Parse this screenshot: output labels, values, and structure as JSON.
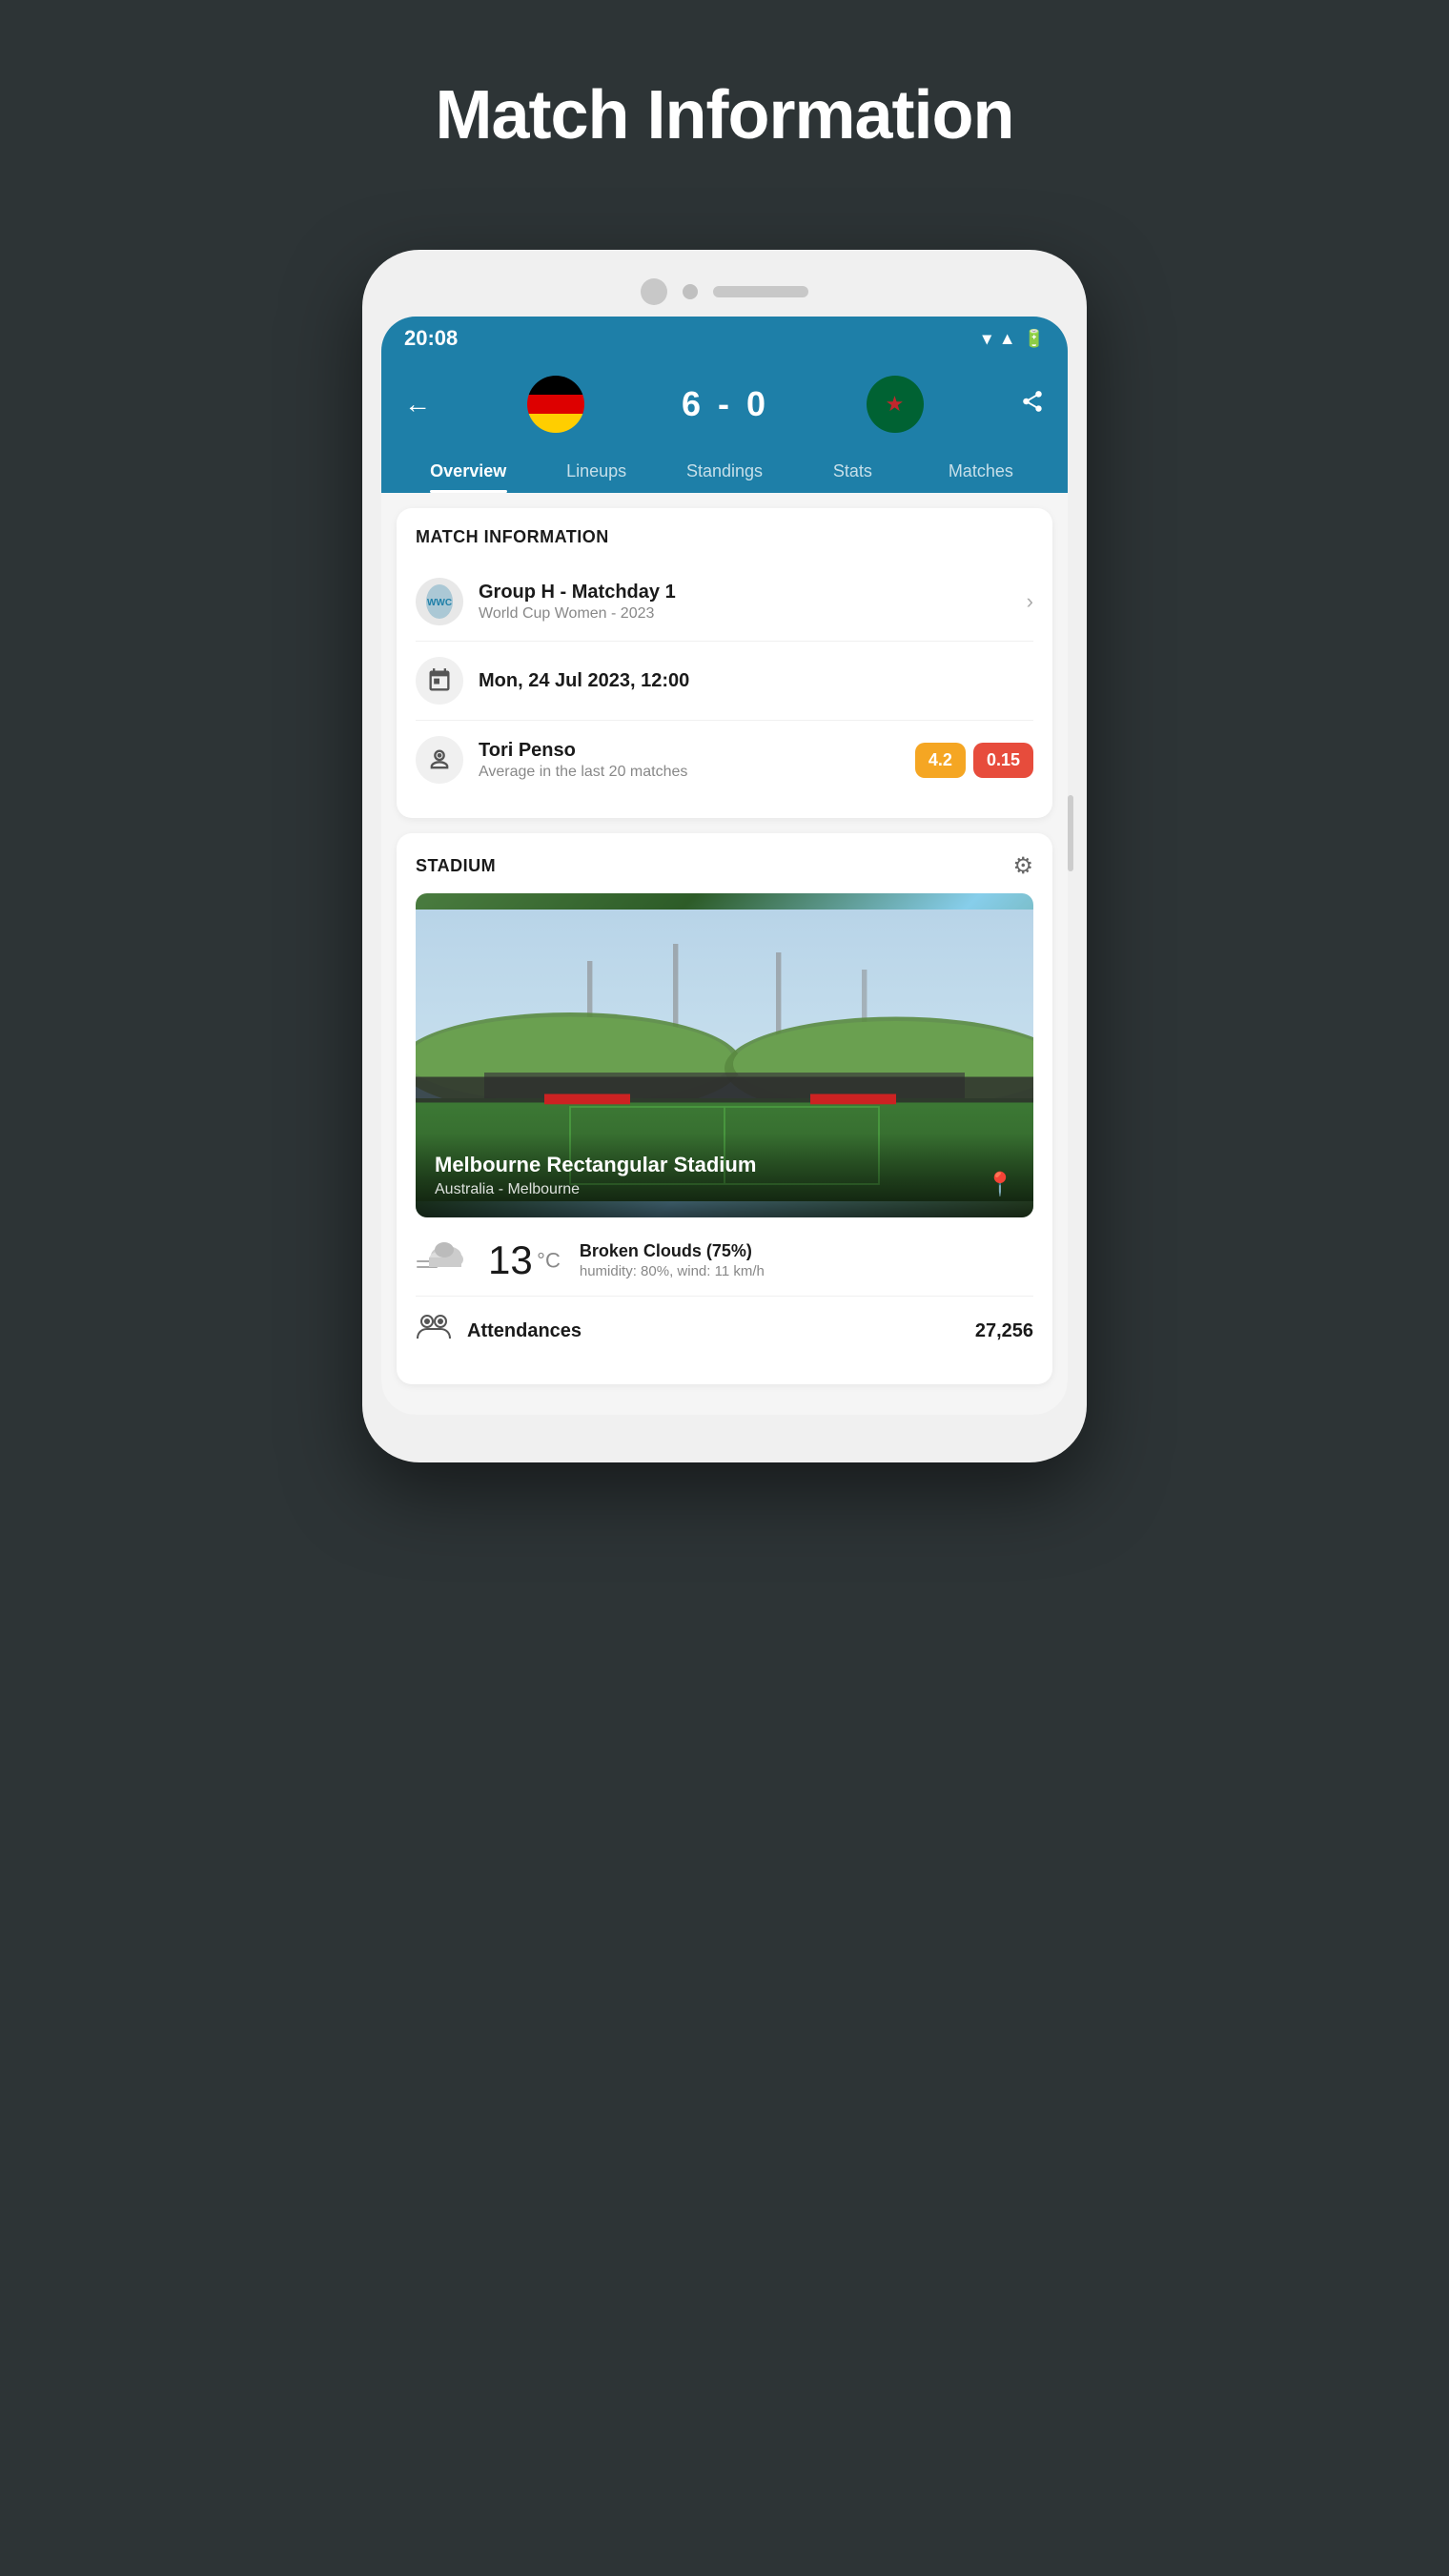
{
  "page": {
    "title": "Match Information"
  },
  "statusBar": {
    "time": "20:08"
  },
  "header": {
    "score": "6 - 0",
    "backLabel": "←",
    "shareLabel": "share"
  },
  "tabs": [
    {
      "label": "Overview",
      "active": true
    },
    {
      "label": "Lineups",
      "active": false
    },
    {
      "label": "Standings",
      "active": false
    },
    {
      "label": "Stats",
      "active": false
    },
    {
      "label": "Matches",
      "active": false
    }
  ],
  "matchInfo": {
    "sectionTitle": "MATCH INFORMATION",
    "competition": {
      "name": "Group H - Matchday 1",
      "subtitle": "World Cup Women - 2023"
    },
    "dateTime": "Mon, 24 Jul 2023, 12:00",
    "referee": {
      "name": "Tori Penso",
      "subtitle": "Average in the last 20 matches",
      "badge1": "4.2",
      "badge2": "0.15"
    }
  },
  "stadium": {
    "sectionTitle": "STADIUM",
    "name": "Melbourne Rectangular Stadium",
    "location": "Australia - Melbourne"
  },
  "weather": {
    "temperature": "13",
    "unit": "°C",
    "description": "Broken Clouds (75%)",
    "details": "humidity: 80%, wind: 11 km/h"
  },
  "attendance": {
    "label": "Attendances",
    "value": "27,256"
  }
}
